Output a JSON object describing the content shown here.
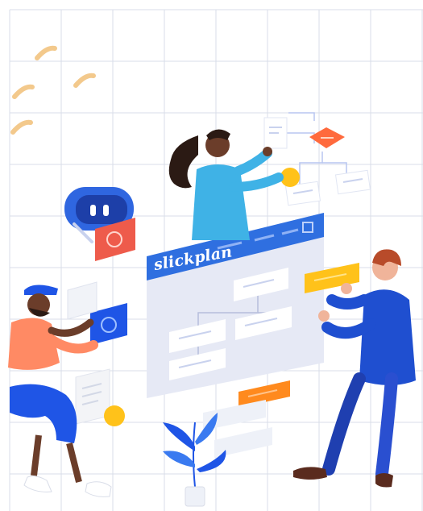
{
  "brand": {
    "name": "slickplan"
  },
  "colors": {
    "grid": "#d9dde8",
    "board": "#e6e9f5",
    "board_header": "#2f6fe0",
    "accent_orange": "#ff7a2e",
    "accent_yellow": "#ffc21a",
    "card_white": "#ffffff",
    "person_blue": "#1f4fd0",
    "tile_red": "#ee5b4b"
  },
  "icons": {
    "robot": "robot-icon",
    "headset": "headset-icon",
    "plant": "plant-icon"
  }
}
